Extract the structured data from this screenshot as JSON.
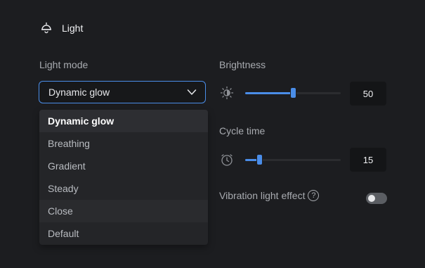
{
  "section": {
    "title": "Light",
    "icon": "ceiling-lamp-icon"
  },
  "light_mode": {
    "label": "Light mode",
    "selected": "Dynamic glow",
    "options": [
      "Dynamic glow",
      "Breathing",
      "Gradient",
      "Steady",
      "Close",
      "Default"
    ]
  },
  "brightness": {
    "label": "Brightness",
    "value": "50",
    "level_fraction": 0.5,
    "icon": "brightness-icon"
  },
  "cycle_time": {
    "label": "Cycle time",
    "value": "15",
    "level_fraction": 0.15,
    "icon": "timer-icon"
  },
  "vibration": {
    "label": "Vibration light effect",
    "help": "?",
    "enabled": false
  },
  "colors": {
    "accent": "#4a8de8",
    "background": "#1c1d20",
    "menu_background": "#242528"
  }
}
